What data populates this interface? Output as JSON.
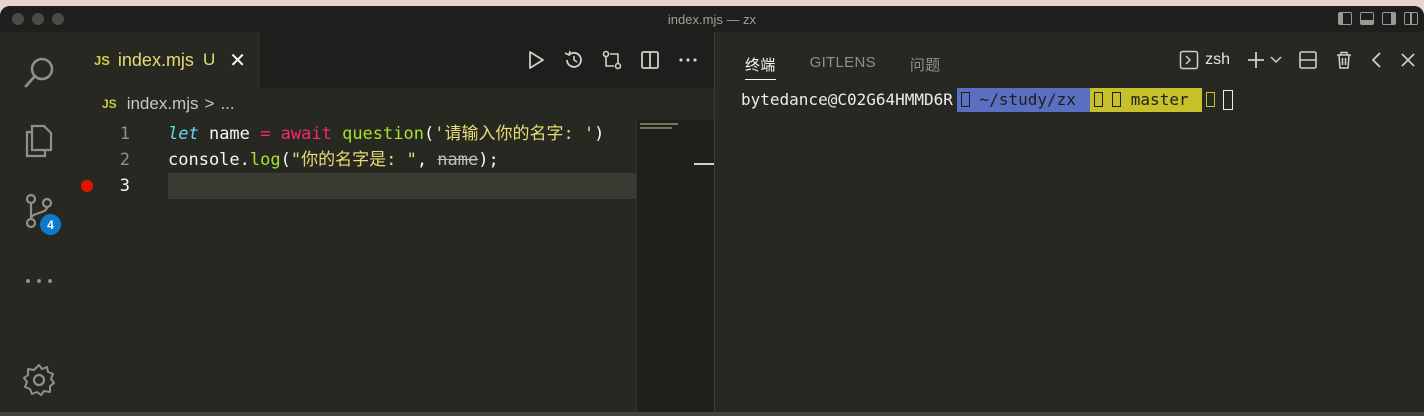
{
  "window": {
    "title": "index.mjs — zx"
  },
  "activity_bar": {
    "items": [
      {
        "name": "search-icon"
      },
      {
        "name": "explorer-icon"
      },
      {
        "name": "source-control-icon",
        "badge": "4"
      },
      {
        "name": "more-icon"
      },
      {
        "name": "settings-gear-icon"
      }
    ]
  },
  "editor": {
    "tab": {
      "lang_badge": "JS",
      "filename": "index.mjs",
      "status": "U",
      "close": "✕"
    },
    "actions": [
      "run-icon",
      "timeline-icon",
      "compare-icon",
      "split-editor-icon",
      "more-actions-icon"
    ],
    "breadcrumb": {
      "lang_badge": "JS",
      "file": "index.mjs",
      "separator": ">",
      "rest": "..."
    },
    "lines": [
      {
        "number": "1",
        "tokens": {
          "kw": "let",
          "name": " name ",
          "eq": "=",
          "sp1": " ",
          "await": "await",
          "sp2": " ",
          "fn": "question",
          "open": "(",
          "str": "'请输入你的名字: '",
          "close": ")"
        }
      },
      {
        "number": "2",
        "tokens": {
          "obj": "console.",
          "fn": "log",
          "open": "(",
          "str": "\"你的名字是: \"",
          "comma": ", ",
          "arg": "name",
          "close": ");"
        }
      },
      {
        "number": "3",
        "breakpoint": true
      }
    ]
  },
  "panel": {
    "tabs": [
      {
        "label": "终端",
        "active": true
      },
      {
        "label": "GITLENS",
        "active": false
      },
      {
        "label": "问题",
        "active": false
      }
    ],
    "shell": "zsh",
    "actions": [
      "new-terminal-icon",
      "dropdown-chevron-icon",
      "split-terminal-icon",
      "trash-icon",
      "chevron-left-icon",
      "close-icon"
    ]
  },
  "terminal": {
    "user": "bytedance@C02G64HMMD6R",
    "dir": " ~/study/zx ",
    "branch": " master "
  },
  "colors": {
    "editor_bg": "#272822",
    "keyword": "#66d9ef",
    "operator": "#f92672",
    "function": "#a6e22e",
    "string": "#e6db74",
    "badge": "#0d7ace",
    "breakpoint": "#e51400",
    "prompt_dir": "#5a6ec2",
    "prompt_git": "#c6c02a"
  }
}
